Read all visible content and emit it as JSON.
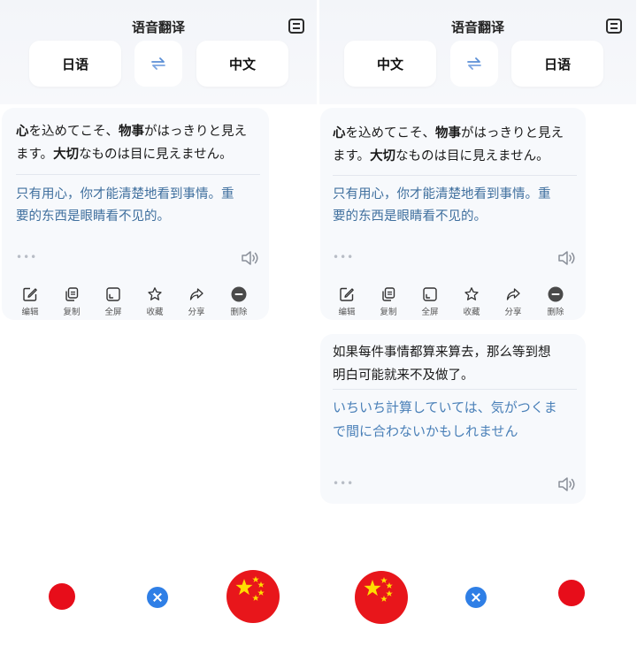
{
  "colors": {
    "accent_blue": "#2f7fe6",
    "translation_text": "#3f6f9e",
    "record_red": "#e70d1a",
    "flag_yellow": "#ffde00"
  },
  "icons": {
    "menu": "list-menu-icon",
    "swap": "swap-arrows-icon",
    "speaker": "speaker-icon",
    "close": "close-icon",
    "flag": "china-flag-icon"
  },
  "left": {
    "title": "语音翻译",
    "source_lang": "日语",
    "target_lang": "中文",
    "card": {
      "source_line1_parts": [
        "心",
        "を込めてこそ、",
        "物事",
        "がはっきりと見え"
      ],
      "source_line2_parts": [
        "ます。",
        "大切",
        "なものは目に見えません。"
      ],
      "target_line1": "只有用心，你才能清楚地看到事情。重",
      "target_line2": "要的东西是眼睛看不见的。",
      "more_dots": "•••"
    },
    "toolbar": {
      "edit": "编辑",
      "copy": "复制",
      "fullscreen": "全屏",
      "favorite": "收藏",
      "share": "分享",
      "delete": "删除"
    }
  },
  "right": {
    "title": "语音翻译",
    "source_lang": "中文",
    "target_lang": "日语",
    "card1": {
      "source_line1_parts": [
        "心",
        "を込めてこそ、",
        "物事",
        "がはっきりと見え"
      ],
      "source_line2_parts": [
        "ます。",
        "大切",
        "なものは目に見えません。"
      ],
      "target_line1": "只有用心，你才能清楚地看到事情。重",
      "target_line2": "要的东西是眼睛看不见的。",
      "more_dots": "•••"
    },
    "toolbar": {
      "edit": "编辑",
      "copy": "复制",
      "fullscreen": "全屏",
      "favorite": "收藏",
      "share": "分享",
      "delete": "删除"
    },
    "card2": {
      "source_line1": "如果每件事情都算来算去，那么等到想",
      "source_line2": "明白可能就来不及做了。",
      "target_line1": "いちいち計算していては、気がつくま",
      "target_line2": "で間に合わないかもしれません",
      "more_dots": "•••"
    }
  }
}
